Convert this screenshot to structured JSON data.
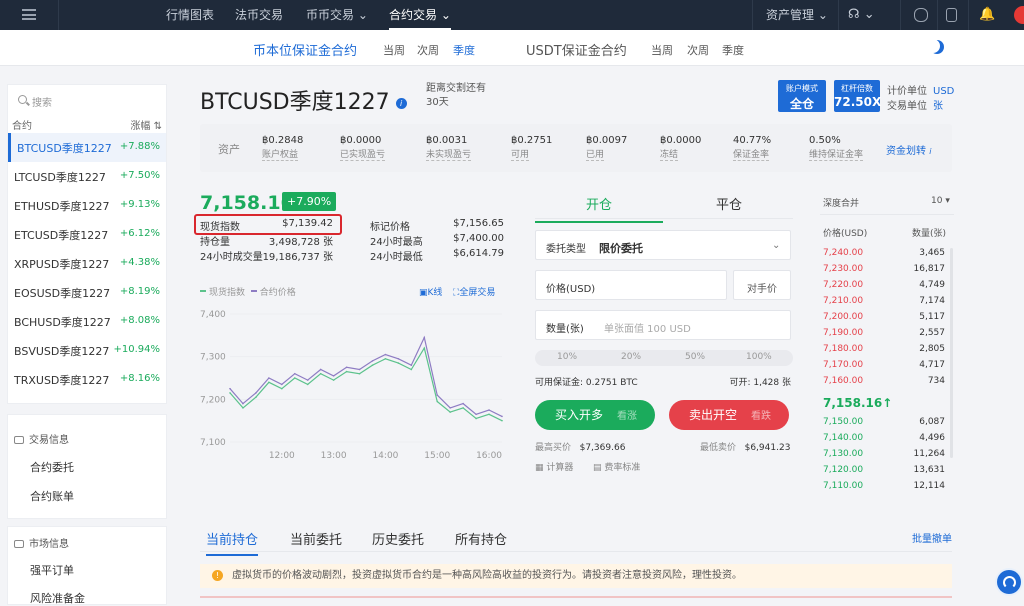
{
  "topnav": {
    "items": [
      "行情图表",
      "法币交易",
      "币币交易",
      "合约交易"
    ],
    "asset_mgmt": "资产管理"
  },
  "subnav": {
    "coin_margin": "币本位保证金合约",
    "usdt_margin": "USDT保证金合约",
    "periods": [
      "当周",
      "次周",
      "季度"
    ]
  },
  "sidebar": {
    "search_placeholder": "搜索",
    "col_contract": "合约",
    "col_change": "涨幅",
    "contracts": [
      {
        "name": "BTCUSD季度1227",
        "change": "+7.88%"
      },
      {
        "name": "LTCUSD季度1227",
        "change": "+7.50%"
      },
      {
        "name": "ETHUSD季度1227",
        "change": "+9.13%"
      },
      {
        "name": "ETCUSD季度1227",
        "change": "+6.12%"
      },
      {
        "name": "XRPUSD季度1227",
        "change": "+4.38%"
      },
      {
        "name": "EOSUSD季度1227",
        "change": "+8.19%"
      },
      {
        "name": "BCHUSD季度1227",
        "change": "+8.08%"
      },
      {
        "name": "BSVUSD季度1227",
        "change": "+10.94%"
      },
      {
        "name": "TRXUSD季度1227",
        "change": "+8.16%"
      }
    ],
    "trade_info": {
      "title": "交易信息",
      "items": [
        "合约委托",
        "合约账单"
      ]
    },
    "market_info": {
      "title": "市场信息",
      "items": [
        "强平订单",
        "风险准备金"
      ]
    }
  },
  "header": {
    "title": "BTCUSD季度1227",
    "settle_label": "距离交割还有",
    "settle_days": "30天",
    "account_mode_label": "账户模式",
    "account_mode": "全仓",
    "leverage_label": "杠杆倍数",
    "leverage": "72.50X",
    "pricing_unit_label": "计价单位",
    "pricing_unit": "USD",
    "trade_unit_label": "交易单位",
    "trade_unit": "张"
  },
  "assets": {
    "label": "资产",
    "transfer": "资金划转",
    "items": [
      {
        "value": "฿0.2848",
        "label": "账户权益"
      },
      {
        "value": "฿0.0000",
        "label": "已实现盈亏"
      },
      {
        "value": "฿0.0031",
        "label": "未实现盈亏"
      },
      {
        "value": "฿0.2751",
        "label": "可用"
      },
      {
        "value": "฿0.0097",
        "label": "已用"
      },
      {
        "value": "฿0.0000",
        "label": "冻结"
      },
      {
        "value": "40.77%",
        "label": "保证金率"
      },
      {
        "value": "0.50%",
        "label": "维持保证金率"
      }
    ]
  },
  "ticker": {
    "price": "7,158.16",
    "change": "+7.90%",
    "stats": [
      {
        "label": "现货指数",
        "value": "$7,139.42"
      },
      {
        "label": "标记价格",
        "value": "$7,156.65"
      },
      {
        "label": "持仓量",
        "value": "3,498,728 张"
      },
      {
        "label": "24小时最高",
        "value": "$7,400.00"
      },
      {
        "label": "24小时成交量",
        "value": "19,186,737 张"
      },
      {
        "label": "24小时最低",
        "value": "$6,614.79"
      }
    ]
  },
  "chart_legend": {
    "spot": "现货指数",
    "contract": "合约价格",
    "kline": "K线",
    "fullscreen": "全屏交易"
  },
  "chart_data": {
    "type": "line",
    "x": [
      "11:00",
      "11:15",
      "11:30",
      "11:45",
      "12:00",
      "12:15",
      "12:30",
      "12:45",
      "13:00",
      "13:15",
      "13:30",
      "13:45",
      "14:00",
      "14:15",
      "14:30",
      "14:45",
      "15:00",
      "15:15",
      "15:30",
      "15:45",
      "16:00",
      "16:15"
    ],
    "x_ticks": [
      "12:00",
      "13:00",
      "14:00",
      "15:00",
      "16:00"
    ],
    "y_ticks": [
      "7,400",
      "7,300",
      "7,200",
      "7,100"
    ],
    "ylim": [
      7100,
      7400
    ],
    "series": [
      {
        "name": "合约价格",
        "color": "#8e7cc3",
        "values": [
          7225,
          7190,
          7215,
          7250,
          7235,
          7260,
          7245,
          7270,
          7255,
          7275,
          7270,
          7290,
          7305,
          7295,
          7280,
          7345,
          7210,
          7180,
          7190,
          7165,
          7175,
          7160
        ]
      },
      {
        "name": "现货指数",
        "color": "#5cc28c",
        "values": [
          7215,
          7180,
          7205,
          7240,
          7225,
          7250,
          7235,
          7260,
          7245,
          7265,
          7260,
          7280,
          7295,
          7285,
          7270,
          7320,
          7195,
          7170,
          7180,
          7155,
          7165,
          7150
        ]
      }
    ]
  },
  "order": {
    "open": "开仓",
    "close": "平仓",
    "type_label": "委托类型",
    "type_value": "限价委托",
    "price_label": "价格(USD)",
    "counter_price": "对手价",
    "qty_label": "数量(张)",
    "qty_placeholder": "单张面值 100 USD",
    "pcts": [
      "10%",
      "20%",
      "50%",
      "100%"
    ],
    "avail_margin": "可用保证金: 0.2751 BTC",
    "can_open": "可开: 1,428 张",
    "buy": "买入开多",
    "buy_hint": "看涨",
    "sell": "卖出开空",
    "sell_hint": "看跌",
    "best_bid_label": "最高买价",
    "best_bid": "$7,369.66",
    "best_ask_label": "最低卖价",
    "best_ask": "$6,941.23",
    "calculator": "计算器",
    "fee_std": "费率标准"
  },
  "depth": {
    "merge_label": "深度合并",
    "merge_value": "10",
    "col_price": "价格(USD)",
    "col_qty": "数量(张)",
    "asks": [
      [
        "7,240.00",
        "3,465"
      ],
      [
        "7,230.00",
        "16,817"
      ],
      [
        "7,220.00",
        "4,749"
      ],
      [
        "7,210.00",
        "7,174"
      ],
      [
        "7,200.00",
        "5,117"
      ],
      [
        "7,190.00",
        "2,557"
      ],
      [
        "7,180.00",
        "2,805"
      ],
      [
        "7,170.00",
        "4,717"
      ],
      [
        "7,160.00",
        "734"
      ]
    ],
    "last": "7,158.16↑",
    "bids": [
      [
        "7,150.00",
        "6,087"
      ],
      [
        "7,140.00",
        "4,496"
      ],
      [
        "7,130.00",
        "11,264"
      ],
      [
        "7,120.00",
        "13,631"
      ],
      [
        "7,110.00",
        "12,114"
      ]
    ]
  },
  "bottom": {
    "tabs": [
      "当前持仓",
      "当前委托",
      "历史委托",
      "所有持仓"
    ],
    "batch_cancel": "批量撤单",
    "warning": "虚拟货币的价格波动剧烈，投资虚拟货币合约是一种高风险高收益的投资行为。请投资者注意投资风险，理性投资。"
  },
  "colors": {
    "accent": "#1e6bd6",
    "up": "#1bab5c",
    "down": "#e5414a",
    "nav_bg": "#1f2a3a"
  }
}
